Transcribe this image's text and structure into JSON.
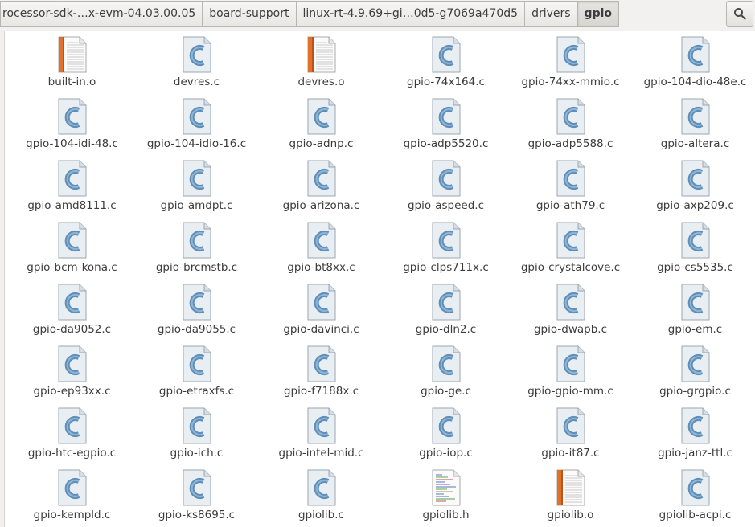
{
  "breadcrumbs": [
    {
      "label": "rocessor-sdk-…x-evm-04.03.00.05",
      "active": false
    },
    {
      "label": "board-support",
      "active": false
    },
    {
      "label": "linux-rt-4.9.69+gi…0d5-g7069a470d5",
      "active": false
    },
    {
      "label": "drivers",
      "active": false
    },
    {
      "label": "gpio",
      "active": true
    }
  ],
  "toolbar": {
    "search_icon": "search-icon"
  },
  "files": [
    {
      "name": "built-in.o",
      "type": "object"
    },
    {
      "name": "devres.c",
      "type": "c-source"
    },
    {
      "name": "devres.o",
      "type": "object"
    },
    {
      "name": "gpio-74x164.c",
      "type": "c-source"
    },
    {
      "name": "gpio-74xx-mmio.c",
      "type": "c-source"
    },
    {
      "name": "gpio-104-dio-48e.c",
      "type": "c-source"
    },
    {
      "name": "gpio-104-idi-48.c",
      "type": "c-source"
    },
    {
      "name": "gpio-104-idio-16.c",
      "type": "c-source"
    },
    {
      "name": "gpio-adnp.c",
      "type": "c-source"
    },
    {
      "name": "gpio-adp5520.c",
      "type": "c-source"
    },
    {
      "name": "gpio-adp5588.c",
      "type": "c-source"
    },
    {
      "name": "gpio-altera.c",
      "type": "c-source"
    },
    {
      "name": "gpio-amd8111.c",
      "type": "c-source"
    },
    {
      "name": "gpio-amdpt.c",
      "type": "c-source"
    },
    {
      "name": "gpio-arizona.c",
      "type": "c-source"
    },
    {
      "name": "gpio-aspeed.c",
      "type": "c-source"
    },
    {
      "name": "gpio-ath79.c",
      "type": "c-source"
    },
    {
      "name": "gpio-axp209.c",
      "type": "c-source"
    },
    {
      "name": "gpio-bcm-kona.c",
      "type": "c-source"
    },
    {
      "name": "gpio-brcmstb.c",
      "type": "c-source"
    },
    {
      "name": "gpio-bt8xx.c",
      "type": "c-source"
    },
    {
      "name": "gpio-clps711x.c",
      "type": "c-source"
    },
    {
      "name": "gpio-crystalcove.c",
      "type": "c-source"
    },
    {
      "name": "gpio-cs5535.c",
      "type": "c-source"
    },
    {
      "name": "gpio-da9052.c",
      "type": "c-source"
    },
    {
      "name": "gpio-da9055.c",
      "type": "c-source"
    },
    {
      "name": "gpio-davinci.c",
      "type": "c-source"
    },
    {
      "name": "gpio-dln2.c",
      "type": "c-source"
    },
    {
      "name": "gpio-dwapb.c",
      "type": "c-source"
    },
    {
      "name": "gpio-em.c",
      "type": "c-source"
    },
    {
      "name": "gpio-ep93xx.c",
      "type": "c-source"
    },
    {
      "name": "gpio-etraxfs.c",
      "type": "c-source"
    },
    {
      "name": "gpio-f7188x.c",
      "type": "c-source"
    },
    {
      "name": "gpio-ge.c",
      "type": "c-source"
    },
    {
      "name": "gpio-gpio-mm.c",
      "type": "c-source"
    },
    {
      "name": "gpio-grgpio.c",
      "type": "c-source"
    },
    {
      "name": "gpio-htc-egpio.c",
      "type": "c-source"
    },
    {
      "name": "gpio-ich.c",
      "type": "c-source"
    },
    {
      "name": "gpio-intel-mid.c",
      "type": "c-source"
    },
    {
      "name": "gpio-iop.c",
      "type": "c-source"
    },
    {
      "name": "gpio-it87.c",
      "type": "c-source"
    },
    {
      "name": "gpio-janz-ttl.c",
      "type": "c-source"
    },
    {
      "name": "gpio-kempld.c",
      "type": "c-source"
    },
    {
      "name": "gpio-ks8695.c",
      "type": "c-source"
    },
    {
      "name": "gpiolib.c",
      "type": "c-source"
    },
    {
      "name": "gpiolib.h",
      "type": "header"
    },
    {
      "name": "gpiolib.o",
      "type": "object"
    },
    {
      "name": "gpiolib-acpi.c",
      "type": "c-source"
    }
  ],
  "colors": {
    "c_icon_blue": "#5f8fb8",
    "object_icon_orange": "#e2702a",
    "header_icon_lines": "#6f8fc8"
  }
}
